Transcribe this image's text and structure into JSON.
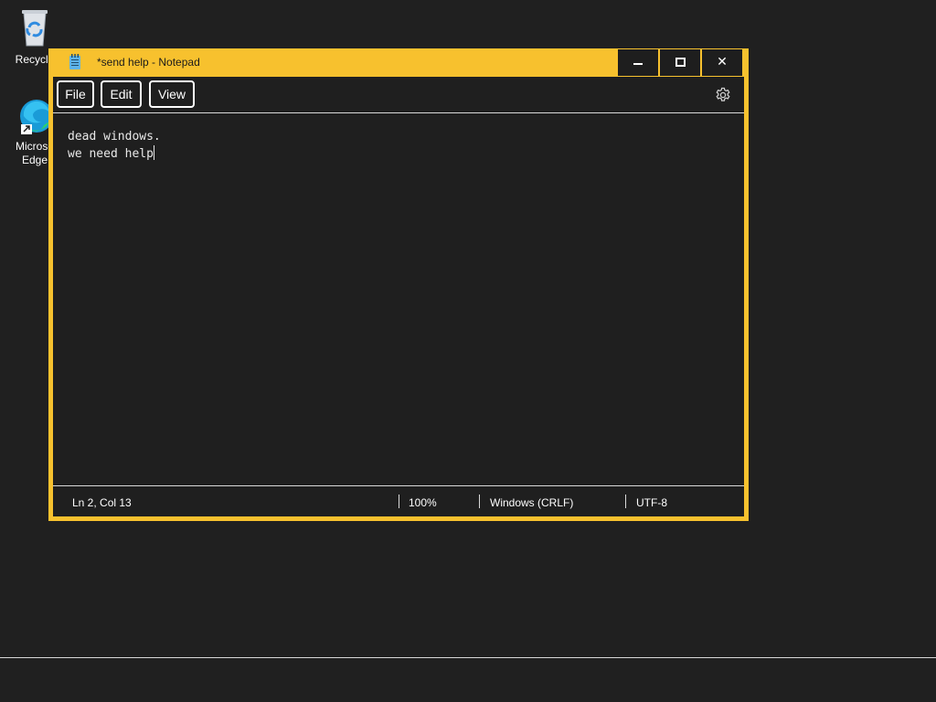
{
  "desktop": {
    "icons": [
      {
        "label": "Recycle",
        "icon": "recycle-bin-icon"
      },
      {
        "label": "Microso\nEdge",
        "icon": "edge-icon"
      }
    ]
  },
  "window": {
    "title": "*send help - Notepad",
    "icon": "notepad-icon",
    "controls": {
      "minimize_icon": "minimize-icon",
      "maximize_icon": "maximize-icon",
      "close_label": "✕"
    },
    "accent_color": "#f7c12e"
  },
  "menu": {
    "file": "File",
    "edit": "Edit",
    "view": "View",
    "settings_icon": "gear-icon"
  },
  "editor": {
    "line1": "dead windows.",
    "line2": "we need help"
  },
  "status": {
    "position": "Ln 2, Col 13",
    "zoom": "100%",
    "line_ending": "Windows (CRLF)",
    "encoding": "UTF-8"
  }
}
